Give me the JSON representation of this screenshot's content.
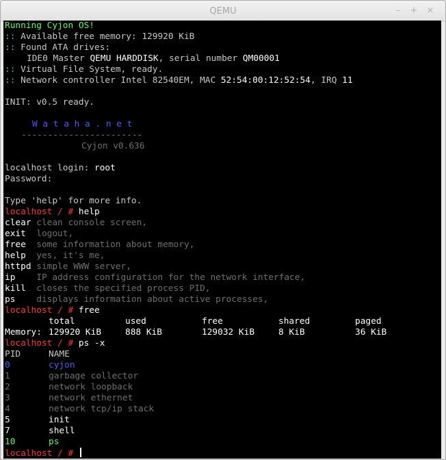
{
  "window": {
    "title": "QEMU",
    "min_label": "–",
    "max_label": "+",
    "close_label": "×"
  },
  "console": {
    "boot": {
      "line1": "Running Cyjon OS!",
      "mem_prefix": ":: ",
      "mem_text": "Available free memory: 129920 KiB",
      "ata_prefix": ":: ",
      "ata_text": "Found ATA drives:",
      "ide_pre": "IDE0 Master ",
      "ide_name": "QEMU HARDDISK",
      "ide_mid": ", serial number ",
      "ide_serial": "QM00001",
      "vfs_prefix": ":: ",
      "vfs_text": "Virtual File System, ready.",
      "net_prefix": ":: ",
      "net_text": "Network controller Intel 82540EM, MAC ",
      "net_mac": "52:54:00:12:52:54",
      "net_irq": ", IRQ ",
      "net_irq_num": "11",
      "init": "INIT: v0.5 ready."
    },
    "banner": {
      "brand": "W a t a h a . n e t",
      "rule": "-----------------------",
      "version": "Cyjon v0.636"
    },
    "login": {
      "prompt": "localhost login: ",
      "user": "root",
      "password": "Password:"
    },
    "hint": "Type 'help' for more info.",
    "prompt": "localhost / # ",
    "cmd_help": "help",
    "help_items": [
      {
        "cmd": "clear ",
        "desc": "clean console screen,"
      },
      {
        "cmd": "exit  ",
        "desc": "logout,"
      },
      {
        "cmd": "free  ",
        "desc": "some information about memory,"
      },
      {
        "cmd": "help  ",
        "desc": "yes, it's me,"
      },
      {
        "cmd": "httpd ",
        "desc": "simple WWW server,"
      },
      {
        "cmd": "ip    ",
        "desc": "IP address configuration for the network interface,"
      },
      {
        "cmd": "kill  ",
        "desc": "closes the specified process PID,"
      },
      {
        "cmd": "ps    ",
        "desc": "displays information about active processes,"
      }
    ],
    "cmd_free": "free",
    "free_table": {
      "headers": [
        "total",
        "used",
        "free",
        "shared",
        "paged"
      ],
      "row_label": "Memory:",
      "values": [
        "129920 KiB",
        "888 KiB",
        "129032 KiB",
        "8 KiB",
        "36 KiB"
      ]
    },
    "cmd_ps": "ps -x",
    "ps_table": {
      "headers": [
        "PID",
        "NAME"
      ],
      "rows": [
        {
          "pid": "0",
          "name": "cyjon"
        },
        {
          "pid": "1",
          "name": "garbage collector"
        },
        {
          "pid": "2",
          "name": "network loopback"
        },
        {
          "pid": "3",
          "name": "network ethernet"
        },
        {
          "pid": "4",
          "name": "network tcp/ip stack"
        },
        {
          "pid": "5",
          "name": "init"
        },
        {
          "pid": "7",
          "name": "shell"
        },
        {
          "pid": "10",
          "name": "ps"
        }
      ]
    }
  }
}
